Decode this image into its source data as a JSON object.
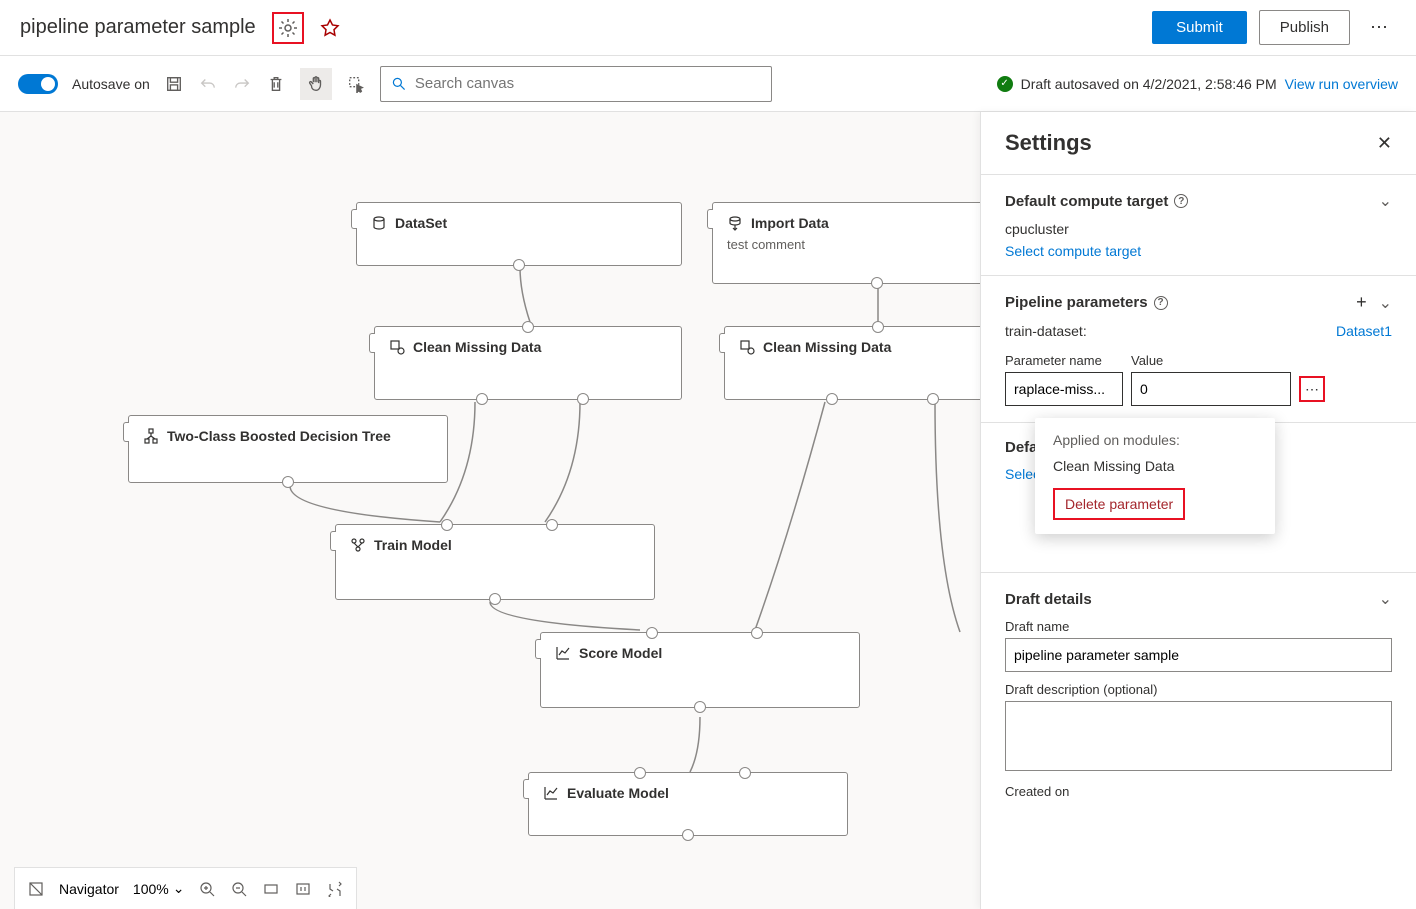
{
  "header": {
    "title": "pipeline parameter sample",
    "submit": "Submit",
    "publish": "Publish"
  },
  "toolbar": {
    "autosave": "Autosave on",
    "search_placeholder": "Search canvas",
    "status": "Draft autosaved on 4/2/2021, 2:58:46 PM",
    "view_run": "View run overview"
  },
  "nodes": {
    "dataset": "DataSet",
    "import_data": "Import Data",
    "import_sub": "test comment",
    "clean1": "Clean Missing Data",
    "clean2": "Clean Missing Data",
    "twoclass": "Two-Class Boosted Decision Tree",
    "train": "Train Model",
    "score": "Score Model",
    "evaluate": "Evaluate Model"
  },
  "settings": {
    "title": "Settings",
    "compute_section": "Default compute target",
    "compute_name": "cpucluster",
    "select_compute": "Select compute target",
    "params_section": "Pipeline parameters",
    "train_dataset_label": "train-dataset:",
    "train_dataset_value": "Dataset1",
    "param_name_label": "Parameter name",
    "param_value_label": "Value",
    "param_name": "raplace-miss...",
    "param_value": "0",
    "default_section": "Default",
    "select_trunc": "Select c",
    "popup_label": "Applied on modules:",
    "popup_item": "Clean Missing Data",
    "delete": "Delete parameter",
    "draft_section": "Draft details",
    "draft_name_label": "Draft name",
    "draft_name": "pipeline parameter sample",
    "draft_desc_label": "Draft description (optional)",
    "created_on": "Created on"
  },
  "bottombar": {
    "navigator": "Navigator",
    "zoom": "100%"
  }
}
